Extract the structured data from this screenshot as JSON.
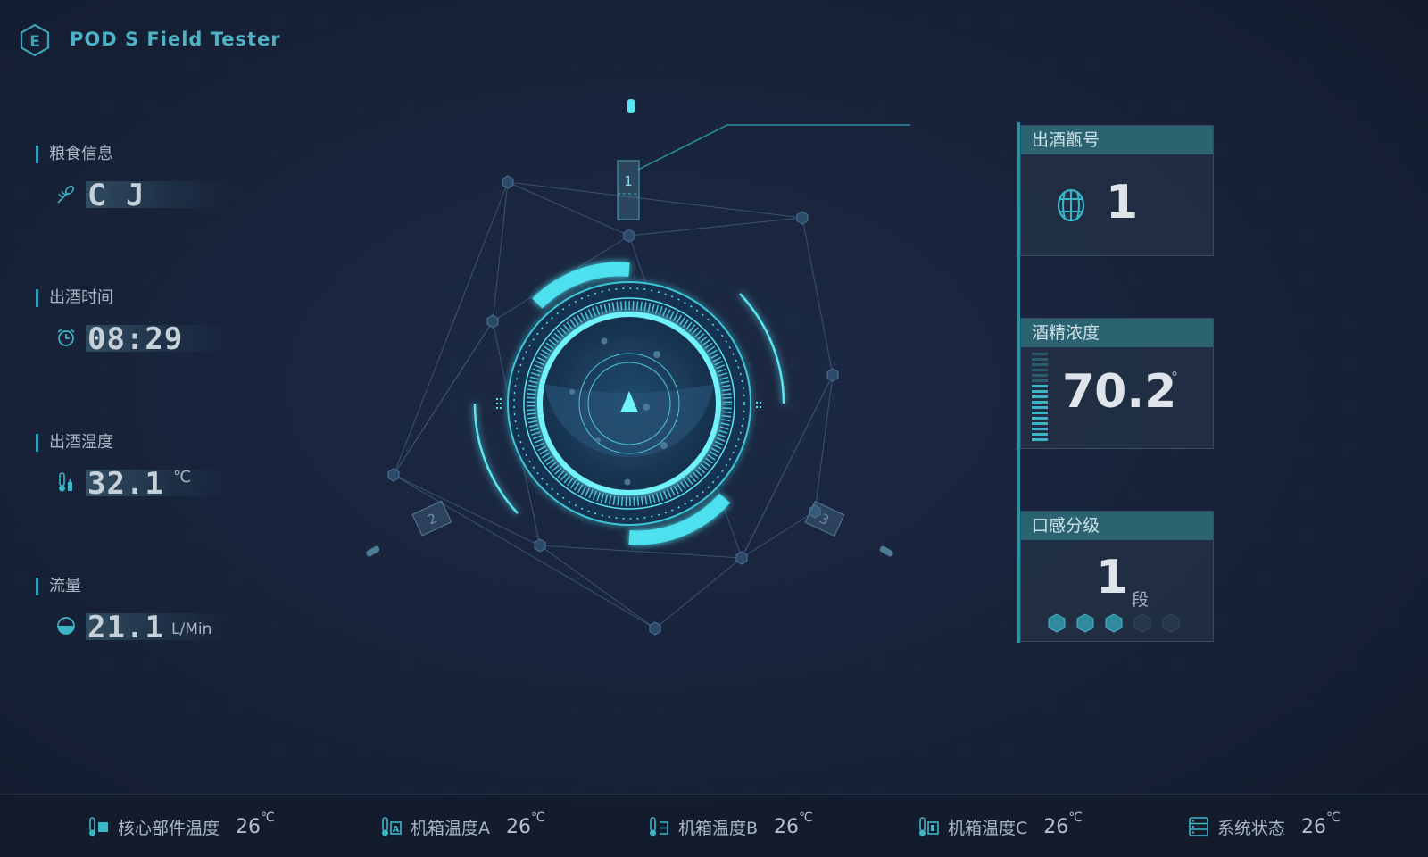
{
  "app": {
    "title": "POD S Field Tester",
    "logo_letter": "E"
  },
  "left_panel": {
    "items": [
      {
        "label": "粮食信息",
        "value": "C J",
        "unit": "",
        "icon": "wheat-icon"
      },
      {
        "label": "出酒时间",
        "value": "08:29",
        "unit": "",
        "icon": "alarm-clock-icon"
      },
      {
        "label": "出酒温度",
        "value": "32.1",
        "unit": "℃",
        "icon": "thermometer-icon"
      },
      {
        "label": "流量",
        "value": "21.1",
        "unit": "L/Min",
        "icon": "flow-gauge-icon"
      }
    ]
  },
  "center": {
    "markers": [
      "1",
      "2",
      "3"
    ]
  },
  "right_panel": {
    "cards": [
      {
        "title": "出酒甑号",
        "value": "1",
        "unit": "",
        "icon": "barrel-icon"
      },
      {
        "title": "酒精浓度",
        "value": "70.2",
        "unit": "°",
        "icon": "level-bars-icon"
      },
      {
        "title": "口感分级",
        "value": "1",
        "unit": "段",
        "rating": 3,
        "rating_max": 5
      }
    ]
  },
  "footer": {
    "items": [
      {
        "label": "核心部件温度",
        "value": "26",
        "unit": "℃",
        "icon": "core-temp-icon"
      },
      {
        "label": "机箱温度A",
        "value": "26",
        "unit": "℃",
        "icon": "case-temp-a-icon"
      },
      {
        "label": "机箱温度B",
        "value": "26",
        "unit": "℃",
        "icon": "case-temp-b-icon"
      },
      {
        "label": "机箱温度C",
        "value": "26",
        "unit": "℃",
        "icon": "case-temp-c-icon"
      },
      {
        "label": "系统状态",
        "value": "26",
        "unit": "℃",
        "icon": "server-status-icon"
      }
    ]
  },
  "colors": {
    "accent": "#2ea3b7",
    "glow": "#58e6f2",
    "panel_head": "#2b6371",
    "background": "#172238"
  }
}
